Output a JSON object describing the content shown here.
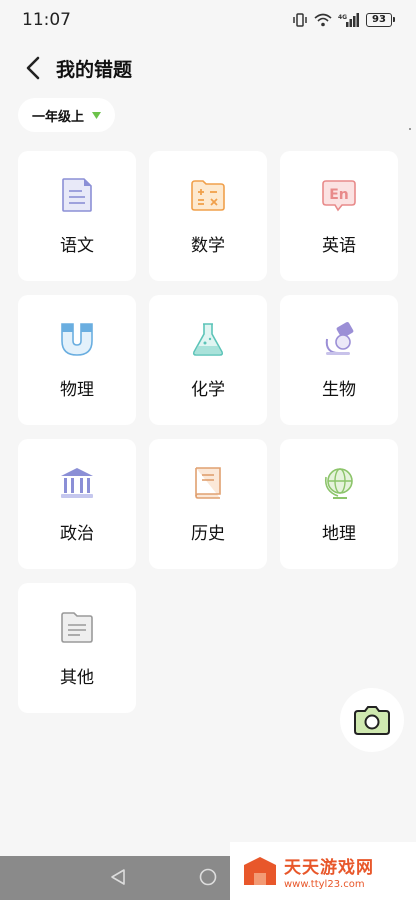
{
  "status": {
    "time": "11:07",
    "battery": "93",
    "network": "4G"
  },
  "header": {
    "title": "我的错题"
  },
  "grade": {
    "label": "一年级上",
    "accent": "#6cc24a"
  },
  "subjects": [
    {
      "label": "语文",
      "icon": "document-icon",
      "color": "#8b8fd6"
    },
    {
      "label": "数学",
      "icon": "calculator-folder-icon",
      "color": "#f0a04b"
    },
    {
      "label": "英语",
      "icon": "en-bubble-icon",
      "color": "#e88a8a"
    },
    {
      "label": "物理",
      "icon": "magnet-icon",
      "color": "#6aaee0"
    },
    {
      "label": "化学",
      "icon": "flask-icon",
      "color": "#5cc4b8"
    },
    {
      "label": "生物",
      "icon": "microscope-icon",
      "color": "#9b8fd6"
    },
    {
      "label": "政治",
      "icon": "pillar-building-icon",
      "color": "#8b8fd6"
    },
    {
      "label": "历史",
      "icon": "book-icon",
      "color": "#e0a070"
    },
    {
      "label": "地理",
      "icon": "globe-icon",
      "color": "#8cc46a"
    },
    {
      "label": "其他",
      "icon": "folder-lines-icon",
      "color": "#9a9a9a"
    }
  ],
  "watermark": {
    "title": "天天游戏网",
    "url": "www.ttyl23.com"
  }
}
